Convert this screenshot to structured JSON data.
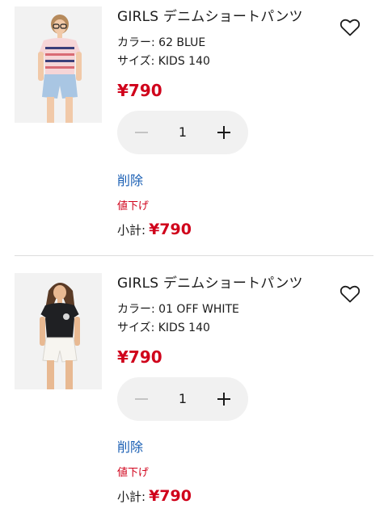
{
  "colors": {
    "price_red": "#d0021b",
    "link_blue": "#1a5fb4",
    "stepper_bg": "#f1f1f1"
  },
  "cart_items": [
    {
      "name": "GIRLS デニムショートパンツ",
      "color": "カラー: 62 BLUE",
      "size": "サイズ: KIDS 140",
      "price": "¥790",
      "quantity": "1",
      "remove_label": "削除",
      "markdown_label": "値下げ",
      "subtotal_label": "小計:",
      "subtotal_value": "¥790",
      "favorite_icon": "heart-outline-icon",
      "stepper_icons": [
        "minus-icon",
        "plus-icon"
      ]
    },
    {
      "name": "GIRLS デニムショートパンツ",
      "color": "カラー: 01 OFF WHITE",
      "size": "サイズ: KIDS 140",
      "price": "¥790",
      "quantity": "1",
      "remove_label": "削除",
      "markdown_label": "値下げ",
      "subtotal_label": "小計:",
      "subtotal_value": "¥790",
      "favorite_icon": "heart-outline-icon",
      "stepper_icons": [
        "minus-icon",
        "plus-icon"
      ]
    }
  ]
}
